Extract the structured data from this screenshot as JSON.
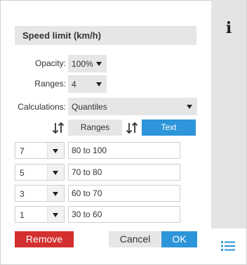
{
  "title": "Speed limit (km/h)",
  "opacity": {
    "label": "Opacity:",
    "value": "100%"
  },
  "ranges": {
    "label": "Ranges:",
    "value": "4"
  },
  "calculations": {
    "label": "Calculations:",
    "value": "Quantiles"
  },
  "toggles": {
    "ranges_label": "Ranges",
    "text_label": "Text",
    "active": "Text"
  },
  "rows": [
    {
      "select": "7",
      "text": "80 to 100"
    },
    {
      "select": "5",
      "text": "70 to 80"
    },
    {
      "select": "3",
      "text": "60 to 70"
    },
    {
      "select": "1",
      "text": "30 to 60"
    }
  ],
  "buttons": {
    "remove": "Remove",
    "cancel": "Cancel",
    "ok": "OK"
  },
  "icons": {
    "info": "info-icon",
    "sort": "sort-icon",
    "list": "list-icon"
  },
  "colors": {
    "accent": "#2d95d9",
    "danger": "#d32f2f",
    "neutral": "#e6e6e6"
  }
}
